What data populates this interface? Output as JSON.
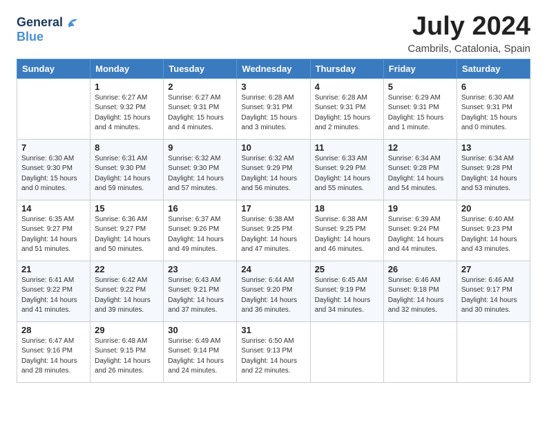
{
  "logo": {
    "line1": "General",
    "line2": "Blue"
  },
  "title": "July 2024",
  "location": "Cambrils, Catalonia, Spain",
  "days_of_week": [
    "Sunday",
    "Monday",
    "Tuesday",
    "Wednesday",
    "Thursday",
    "Friday",
    "Saturday"
  ],
  "weeks": [
    [
      {
        "day": "",
        "info": ""
      },
      {
        "day": "1",
        "info": "Sunrise: 6:27 AM\nSunset: 9:32 PM\nDaylight: 15 hours\nand 4 minutes."
      },
      {
        "day": "2",
        "info": "Sunrise: 6:27 AM\nSunset: 9:31 PM\nDaylight: 15 hours\nand 4 minutes."
      },
      {
        "day": "3",
        "info": "Sunrise: 6:28 AM\nSunset: 9:31 PM\nDaylight: 15 hours\nand 3 minutes."
      },
      {
        "day": "4",
        "info": "Sunrise: 6:28 AM\nSunset: 9:31 PM\nDaylight: 15 hours\nand 2 minutes."
      },
      {
        "day": "5",
        "info": "Sunrise: 6:29 AM\nSunset: 9:31 PM\nDaylight: 15 hours\nand 1 minute."
      },
      {
        "day": "6",
        "info": "Sunrise: 6:30 AM\nSunset: 9:31 PM\nDaylight: 15 hours\nand 0 minutes."
      }
    ],
    [
      {
        "day": "7",
        "info": "Sunrise: 6:30 AM\nSunset: 9:30 PM\nDaylight: 15 hours\nand 0 minutes."
      },
      {
        "day": "8",
        "info": "Sunrise: 6:31 AM\nSunset: 9:30 PM\nDaylight: 14 hours\nand 59 minutes."
      },
      {
        "day": "9",
        "info": "Sunrise: 6:32 AM\nSunset: 9:30 PM\nDaylight: 14 hours\nand 57 minutes."
      },
      {
        "day": "10",
        "info": "Sunrise: 6:32 AM\nSunset: 9:29 PM\nDaylight: 14 hours\nand 56 minutes."
      },
      {
        "day": "11",
        "info": "Sunrise: 6:33 AM\nSunset: 9:29 PM\nDaylight: 14 hours\nand 55 minutes."
      },
      {
        "day": "12",
        "info": "Sunrise: 6:34 AM\nSunset: 9:28 PM\nDaylight: 14 hours\nand 54 minutes."
      },
      {
        "day": "13",
        "info": "Sunrise: 6:34 AM\nSunset: 9:28 PM\nDaylight: 14 hours\nand 53 minutes."
      }
    ],
    [
      {
        "day": "14",
        "info": "Sunrise: 6:35 AM\nSunset: 9:27 PM\nDaylight: 14 hours\nand 51 minutes."
      },
      {
        "day": "15",
        "info": "Sunrise: 6:36 AM\nSunset: 9:27 PM\nDaylight: 14 hours\nand 50 minutes."
      },
      {
        "day": "16",
        "info": "Sunrise: 6:37 AM\nSunset: 9:26 PM\nDaylight: 14 hours\nand 49 minutes."
      },
      {
        "day": "17",
        "info": "Sunrise: 6:38 AM\nSunset: 9:25 PM\nDaylight: 14 hours\nand 47 minutes."
      },
      {
        "day": "18",
        "info": "Sunrise: 6:38 AM\nSunset: 9:25 PM\nDaylight: 14 hours\nand 46 minutes."
      },
      {
        "day": "19",
        "info": "Sunrise: 6:39 AM\nSunset: 9:24 PM\nDaylight: 14 hours\nand 44 minutes."
      },
      {
        "day": "20",
        "info": "Sunrise: 6:40 AM\nSunset: 9:23 PM\nDaylight: 14 hours\nand 43 minutes."
      }
    ],
    [
      {
        "day": "21",
        "info": "Sunrise: 6:41 AM\nSunset: 9:22 PM\nDaylight: 14 hours\nand 41 minutes."
      },
      {
        "day": "22",
        "info": "Sunrise: 6:42 AM\nSunset: 9:22 PM\nDaylight: 14 hours\nand 39 minutes."
      },
      {
        "day": "23",
        "info": "Sunrise: 6:43 AM\nSunset: 9:21 PM\nDaylight: 14 hours\nand 37 minutes."
      },
      {
        "day": "24",
        "info": "Sunrise: 6:44 AM\nSunset: 9:20 PM\nDaylight: 14 hours\nand 36 minutes."
      },
      {
        "day": "25",
        "info": "Sunrise: 6:45 AM\nSunset: 9:19 PM\nDaylight: 14 hours\nand 34 minutes."
      },
      {
        "day": "26",
        "info": "Sunrise: 6:46 AM\nSunset: 9:18 PM\nDaylight: 14 hours\nand 32 minutes."
      },
      {
        "day": "27",
        "info": "Sunrise: 6:46 AM\nSunset: 9:17 PM\nDaylight: 14 hours\nand 30 minutes."
      }
    ],
    [
      {
        "day": "28",
        "info": "Sunrise: 6:47 AM\nSunset: 9:16 PM\nDaylight: 14 hours\nand 28 minutes."
      },
      {
        "day": "29",
        "info": "Sunrise: 6:48 AM\nSunset: 9:15 PM\nDaylight: 14 hours\nand 26 minutes."
      },
      {
        "day": "30",
        "info": "Sunrise: 6:49 AM\nSunset: 9:14 PM\nDaylight: 14 hours\nand 24 minutes."
      },
      {
        "day": "31",
        "info": "Sunrise: 6:50 AM\nSunset: 9:13 PM\nDaylight: 14 hours\nand 22 minutes."
      },
      {
        "day": "",
        "info": ""
      },
      {
        "day": "",
        "info": ""
      },
      {
        "day": "",
        "info": ""
      }
    ]
  ]
}
